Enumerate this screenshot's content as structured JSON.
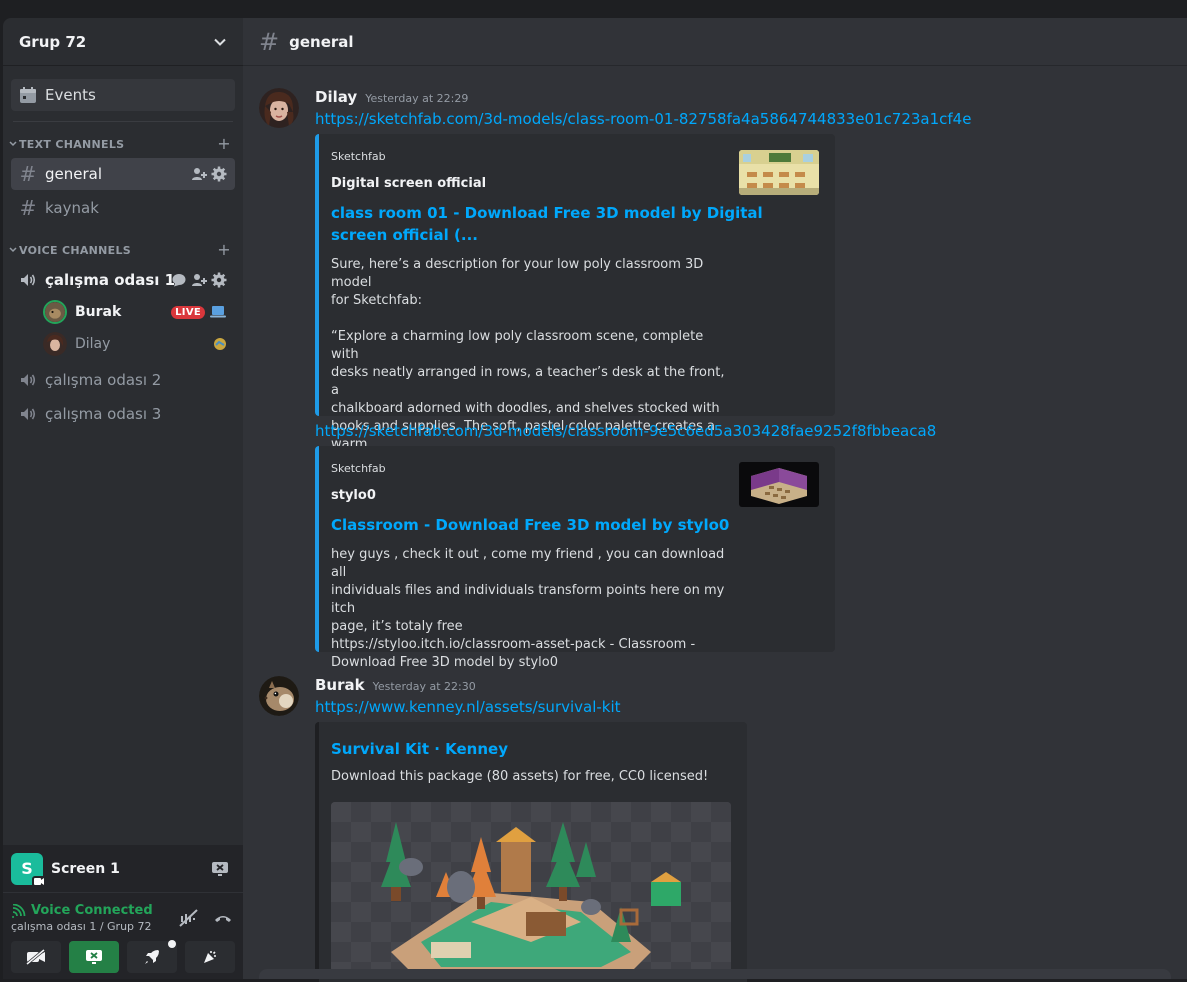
{
  "sidebar": {
    "guild_name": "Grup 72",
    "events_label": "Events",
    "text_category": "TEXT CHANNELS",
    "voice_category": "VOICE CHANNELS",
    "text_channels": [
      {
        "name": "general",
        "active": true
      },
      {
        "name": "kaynak",
        "active": false
      }
    ],
    "voice_channels": [
      {
        "name": "çalışma odası 1"
      },
      {
        "name": "çalışma odası 2"
      },
      {
        "name": "çalışma odası 3"
      }
    ],
    "voice_users": [
      {
        "name": "Burak",
        "badge": "LIVE"
      },
      {
        "name": "Dilay"
      }
    ]
  },
  "screenshare": {
    "icon_letter": "S",
    "name": "Screen 1"
  },
  "voice_panel": {
    "status": "Voice Connected",
    "location": "çalışma odası 1 / Grup 72"
  },
  "channel_header": {
    "name": "general"
  },
  "messages": [
    {
      "author": "Dilay",
      "timestamp": "Yesterday at 22:29",
      "links": [
        {
          "url": "https://sketchfab.com/3d-models/class-room-01-82758fa4a5864744833e01c723a1cf4e",
          "embed": {
            "provider": "Sketchfab",
            "author": "Digital screen official",
            "title_line1": "class room 01 - Download Free 3D model by Digital",
            "title_line2": "screen official (...",
            "description": "Sure, here’s a description for your low poly classroom 3D model\nfor Sketchfab:\n\n“Explore a charming low poly classroom scene, complete with\ndesks neatly arranged in rows, a teacher’s desk at the front, a\nchalkboard adorned with doodles, and shelves stocked with\nbooks and supplies. The soft, pastel color palette creates a warm\nand inviting atmosp..."
          }
        },
        {
          "url": "https://sketchfab.com/3d-models/classroom-9e5c6ed5a303428fae9252f8fbbeaca8",
          "embed": {
            "provider": "Sketchfab",
            "author": "stylo0",
            "title": "Classroom - Download Free 3D model by stylo0",
            "description": "hey guys , check it out , come my friend , you can download all\nindividuals files and individuals transform points here on my itch\npage, it’s totaly free\nhttps://styloo.itch.io/classroom-asset-pack - Classroom -\nDownload Free 3D model by stylo0"
          }
        }
      ]
    },
    {
      "author": "Burak",
      "timestamp": "Yesterday at 22:30",
      "links": [
        {
          "url": "https://www.kenney.nl/assets/survival-kit",
          "embed": {
            "title": "Survival Kit · Kenney",
            "description": "Download this package (80 assets) for free, CC0 licensed!"
          }
        }
      ]
    }
  ],
  "colors": {
    "link": "#00a8fc",
    "embed_accent": "#1e9be8",
    "voice_green": "#23a55a",
    "live_red": "#da373c",
    "background": "#313338",
    "sidebar": "#2b2d31"
  }
}
